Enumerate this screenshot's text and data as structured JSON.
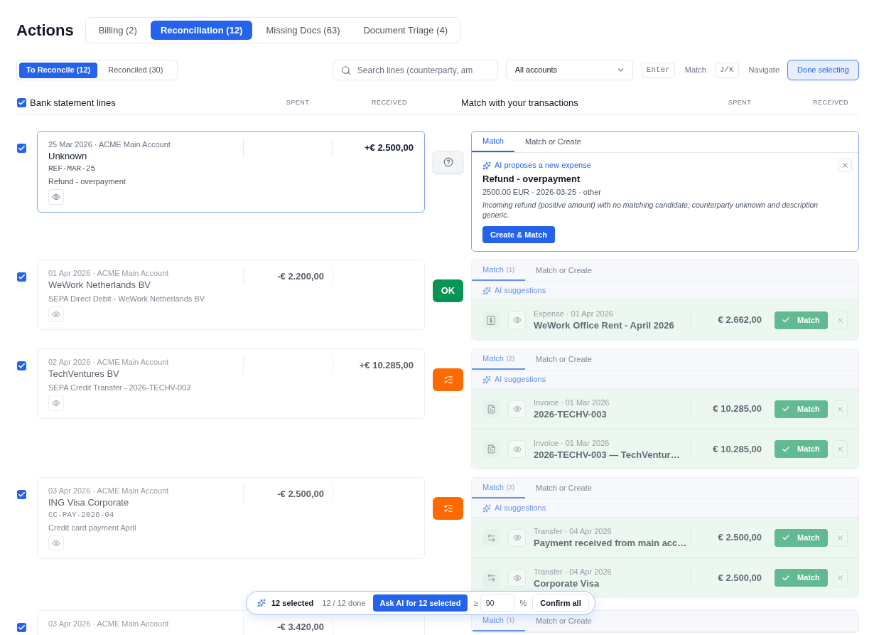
{
  "header": {
    "title": "Actions",
    "tabs": [
      {
        "label": "Billing (2)",
        "selected": false
      },
      {
        "label": "Reconciliation (12)",
        "selected": true
      },
      {
        "label": "Missing Docs (63)",
        "selected": false
      },
      {
        "label": "Document Triage (4)",
        "selected": false
      }
    ]
  },
  "toolbar": {
    "views": [
      {
        "label": "To Reconcile (12)",
        "selected": true
      },
      {
        "label": "Reconciled (30)",
        "selected": false
      }
    ],
    "search": {
      "placeholder": "Search lines (counterparty, am"
    },
    "account_filter": {
      "value": "All accounts"
    },
    "shortcuts": [
      {
        "key": "Enter",
        "label": "Match"
      },
      {
        "key": "J/K",
        "label": "Navigate"
      }
    ],
    "done_button": "Done selecting"
  },
  "bank_header": {
    "label": "Bank statement lines",
    "checked": true,
    "columns": [
      "SPENT",
      "RECEIVED"
    ]
  },
  "match_header": {
    "label": "Match with your transactions",
    "columns": [
      "SPENT",
      "RECEIVED"
    ]
  },
  "rows": [
    {
      "checked": true,
      "focused": true,
      "line": {
        "meta": "25 Mar 2026 · ACME Main Account",
        "counterparty": "Unknown",
        "reference": "REF-MAR-25",
        "description": "Refund - overpayment",
        "received": "+€ 2.500,00"
      },
      "status": {
        "kind": "question"
      },
      "panel": {
        "tabs": [
          {
            "label": "Match",
            "selected": true
          },
          {
            "label": "Match or Create",
            "selected": false
          }
        ],
        "kind": "proposal",
        "heading": "AI proposes a new expense",
        "title": "Refund - overpayment",
        "details": "2500.00 EUR · 2026-03-25 · other",
        "reasoning": "Incoming refund (positive amount) with no matching candidate; counterparty unknown and description generic.",
        "action": "Create & Match"
      }
    },
    {
      "checked": true,
      "focused": false,
      "line": {
        "meta": "01 Apr 2026 · ACME Main Account",
        "counterparty": "WeWork Netherlands BV",
        "description": "SEPA Direct Debit - WeWork Netherlands BV",
        "spent": "-€ 2.200,00"
      },
      "status": {
        "kind": "ok",
        "label": "OK"
      },
      "panel": {
        "tabs": [
          {
            "label": "Match",
            "count": "(1)",
            "selected": true
          },
          {
            "label": "Match or Create",
            "selected": false
          }
        ],
        "kind": "suggestions",
        "heading": "AI suggestions",
        "items": [
          {
            "kind": "expense",
            "meta": "Expense · 01 Apr 2026",
            "title": "WeWork Office Rent - April 2026",
            "amount": "€ 2.662,00",
            "action": "Match"
          }
        ]
      }
    },
    {
      "checked": true,
      "focused": false,
      "line": {
        "meta": "02 Apr 2026 · ACME Main Account",
        "counterparty": "TechVentures BV",
        "description": "SEPA Credit Transfer - 2026-TECHV-003",
        "received": "+€ 10.285,00"
      },
      "status": {
        "kind": "multiple"
      },
      "panel": {
        "tabs": [
          {
            "label": "Match",
            "count": "(2)",
            "selected": true
          },
          {
            "label": "Match or Create",
            "selected": false
          }
        ],
        "kind": "suggestions",
        "heading": "AI suggestions",
        "items": [
          {
            "kind": "invoice",
            "meta": "Invoice · 01 Mar 2026",
            "title": "2026-TECHV-003",
            "amount": "€ 10.285,00",
            "action": "Match"
          },
          {
            "kind": "invoice",
            "meta": "Invoice · 01 Mar 2026",
            "title": "2026-TECHV-003 — TechVentur…",
            "amount": "€ 10.285,00",
            "action": "Match"
          }
        ]
      }
    },
    {
      "checked": true,
      "focused": false,
      "line": {
        "meta": "03 Apr 2026 · ACME Main Account",
        "counterparty": "ING Visa Corporate",
        "reference": "CC-PAY-2026-04",
        "description": "Credit card payment April",
        "spent": "-€ 2.500,00"
      },
      "status": {
        "kind": "multiple"
      },
      "panel": {
        "tabs": [
          {
            "label": "Match",
            "count": "(2)",
            "selected": true
          },
          {
            "label": "Match or Create",
            "selected": false
          }
        ],
        "kind": "suggestions",
        "heading": "AI suggestions",
        "items": [
          {
            "kind": "transfer",
            "meta": "Transfer · 04 Apr 2026",
            "title": "Payment received from main acc…",
            "amount": "€ 2.500,00",
            "action": "Match"
          },
          {
            "kind": "transfer",
            "meta": "Transfer · 04 Apr 2026",
            "title": "Corporate Visa",
            "amount": "€ 2.500,00",
            "action": "Match"
          }
        ]
      }
    },
    {
      "checked": true,
      "focused": false,
      "line": {
        "meta": "03 Apr 2026 · ACME Main Account",
        "spent": "-€ 3.420,00"
      },
      "panel": {
        "tabs": [
          {
            "label": "Match",
            "count": "(1)",
            "selected": true
          },
          {
            "label": "Match or Create",
            "selected": false
          }
        ],
        "kind": "suggestions"
      }
    }
  ],
  "selection_bar": {
    "selected": "12 selected",
    "progress": "12 / 12 done",
    "ask_button": "Ask AI for 12 selected",
    "threshold_prefix": "≥",
    "threshold": "90",
    "threshold_suffix": "%",
    "confirm_button": "Confirm all"
  }
}
